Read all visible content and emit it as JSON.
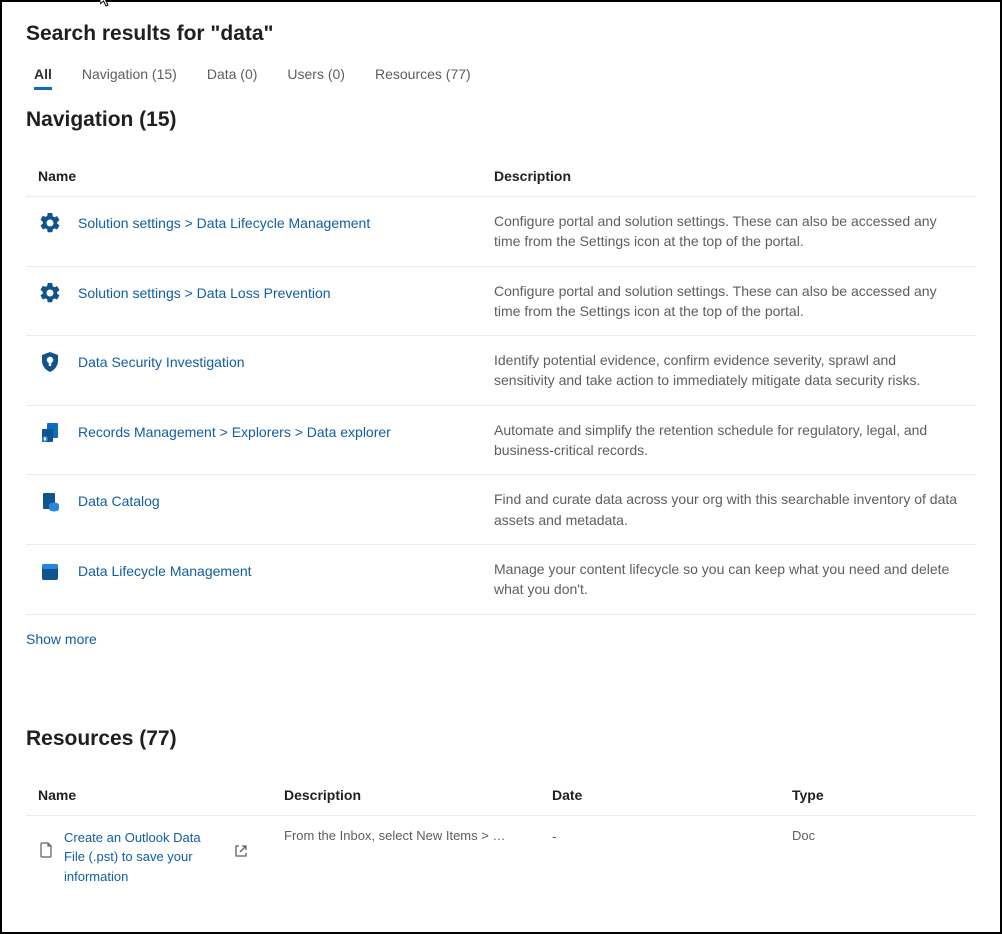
{
  "page_title": "Search results for \"data\"",
  "tabs": [
    {
      "label": "All",
      "active": true
    },
    {
      "label": "Navigation (15)",
      "active": false
    },
    {
      "label": "Data (0)",
      "active": false
    },
    {
      "label": "Users (0)",
      "active": false
    },
    {
      "label": "Resources (77)",
      "active": false
    }
  ],
  "navigation": {
    "title": "Navigation (15)",
    "col_name": "Name",
    "col_desc": "Description",
    "rows": [
      {
        "icon": "gear",
        "name": "Solution settings > Data Lifecycle Management",
        "desc": "Configure portal and solution settings. These can also be accessed any time from the Settings icon at the top of the portal."
      },
      {
        "icon": "gear",
        "name": "Solution settings > Data Loss Prevention",
        "desc": "Configure portal and solution settings. These can also be accessed any time from the Settings icon at the top of the portal."
      },
      {
        "icon": "shield-bulb",
        "name": "Data Security Investigation",
        "desc": "Identify potential evidence, confirm evidence severity, sprawl and sensitivity and take action to immediately mitigate data security risks."
      },
      {
        "icon": "records",
        "name": "Records Management > Explorers > Data explorer",
        "desc": "Automate and simplify the retention schedule for regulatory, legal, and business-critical records."
      },
      {
        "icon": "catalog",
        "name": "Data Catalog",
        "desc": "Find and curate data across your org with this searchable inventory of data assets and metadata."
      },
      {
        "icon": "lifecycle",
        "name": "Data Lifecycle Management",
        "desc": "Manage your content lifecycle so you can keep what you need and delete what you don't."
      }
    ],
    "show_more": "Show more"
  },
  "resources": {
    "title": "Resources (77)",
    "col_name": "Name",
    "col_desc": "Description",
    "col_date": "Date",
    "col_type": "Type",
    "rows": [
      {
        "name": "Create an Outlook Data File (.pst) to save your information",
        "desc": "From the Inbox, select New Items > …",
        "date": "-",
        "type": "Doc"
      }
    ]
  }
}
